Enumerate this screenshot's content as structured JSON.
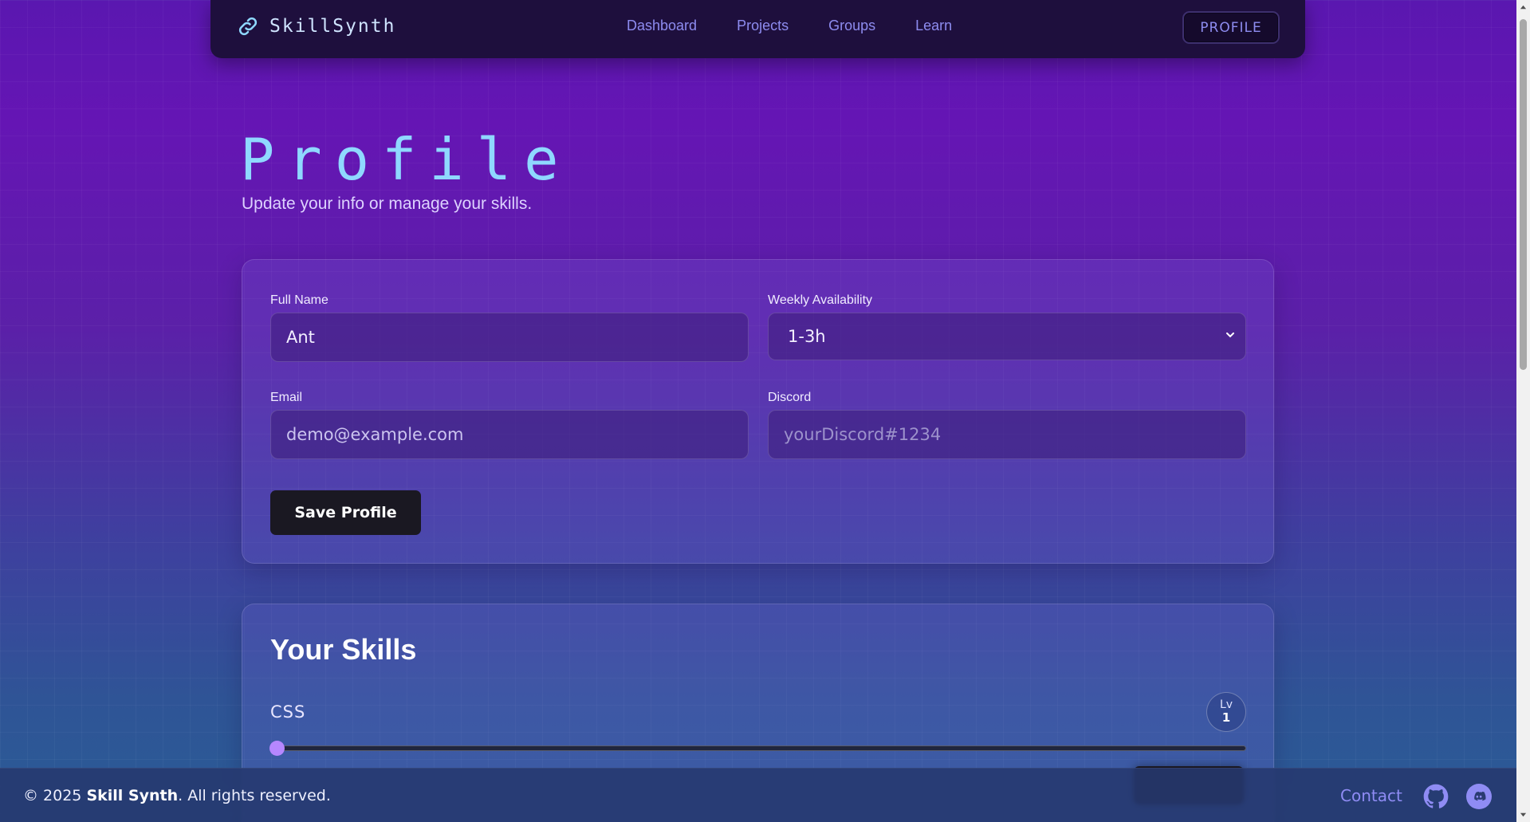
{
  "brand": {
    "name": "SkillSynth",
    "icon": "link-icon",
    "accent_color": "#8fd8ff"
  },
  "nav": {
    "links": [
      "Dashboard",
      "Projects",
      "Groups",
      "Learn"
    ],
    "profile_label": "PROFILE"
  },
  "header": {
    "title": "Profile",
    "subtitle": "Update your info or manage your skills."
  },
  "profile_form": {
    "full_name_label": "Full Name",
    "full_name_value": "Ant",
    "availability_label": "Weekly Availability",
    "availability_value": "1-3h",
    "email_label": "Email",
    "email_value": "demo@example.com",
    "discord_label": "Discord",
    "discord_placeholder": "yourDiscord#1234",
    "save_label": "Save Profile"
  },
  "skills": {
    "title": "Your Skills",
    "items": [
      {
        "name": "CSS",
        "level_prefix": "Lv",
        "level": "1",
        "slider_fraction": 0.0
      }
    ]
  },
  "footer": {
    "copyright_prefix": "© 2025 ",
    "copyright_brand": "Skill Synth",
    "copyright_suffix": ". All rights reserved.",
    "contact_label": "Contact",
    "icons": [
      "github-icon",
      "discord-icon"
    ]
  },
  "colors": {
    "nav_bg": "#1e0f3d",
    "nav_link": "#8e8cf0",
    "button_bg": "#1a1822",
    "slider_thumb": "#b687ff"
  }
}
